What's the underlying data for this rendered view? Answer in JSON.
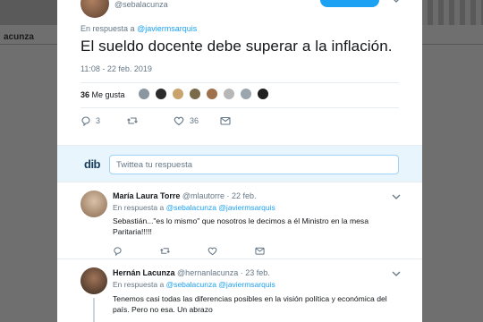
{
  "background": {
    "profile_name": "acunza"
  },
  "tweet": {
    "handle": "@sebalacunza",
    "follow_label": "",
    "reply_prefix": "En respuesta a",
    "reply_to": "@javiermsarquis",
    "text": "El sueldo docente debe superar a la inflación.",
    "timestamp": "11:08 - 22 feb. 2019",
    "likes_count": "36",
    "likes_label": "Me gusta",
    "reply_count": "3",
    "retweet_count": "",
    "like_count": "36"
  },
  "reply_box": {
    "logo_text": "dib",
    "placeholder": "Twittea tu respuesta"
  },
  "replies": [
    {
      "name": "María Laura Torre",
      "handle": "@mlautorre",
      "date": "· 22 feb.",
      "reply_prefix": "En respuesta a",
      "reply_to_1": "@sebalacunza",
      "reply_to_2": "@javiermsarquis",
      "body": "Sebastián...\"es lo mismo\" que nosotros le decimos a él Ministro en la mesa Paritaria!!!!!"
    },
    {
      "name": "Hernán Lacunza",
      "handle": "@hernanlacunza",
      "date": "· 23 feb.",
      "reply_prefix": "En respuesta a",
      "reply_to_1": "@sebalacunza",
      "reply_to_2": "@javiermsarquis",
      "body": "Tenemos casi todas las diferencias posibles en la visión política y económica del país. Pero no esa. Un abrazo"
    }
  ],
  "colors": {
    "accent": "#1da1f2",
    "secondary_text": "#657786",
    "primary_text": "#14171a",
    "reply_bg": "#e8f5fd"
  },
  "icons": [
    "reply-icon",
    "retweet-icon",
    "like-icon",
    "message-icon",
    "chevron-down-icon"
  ]
}
